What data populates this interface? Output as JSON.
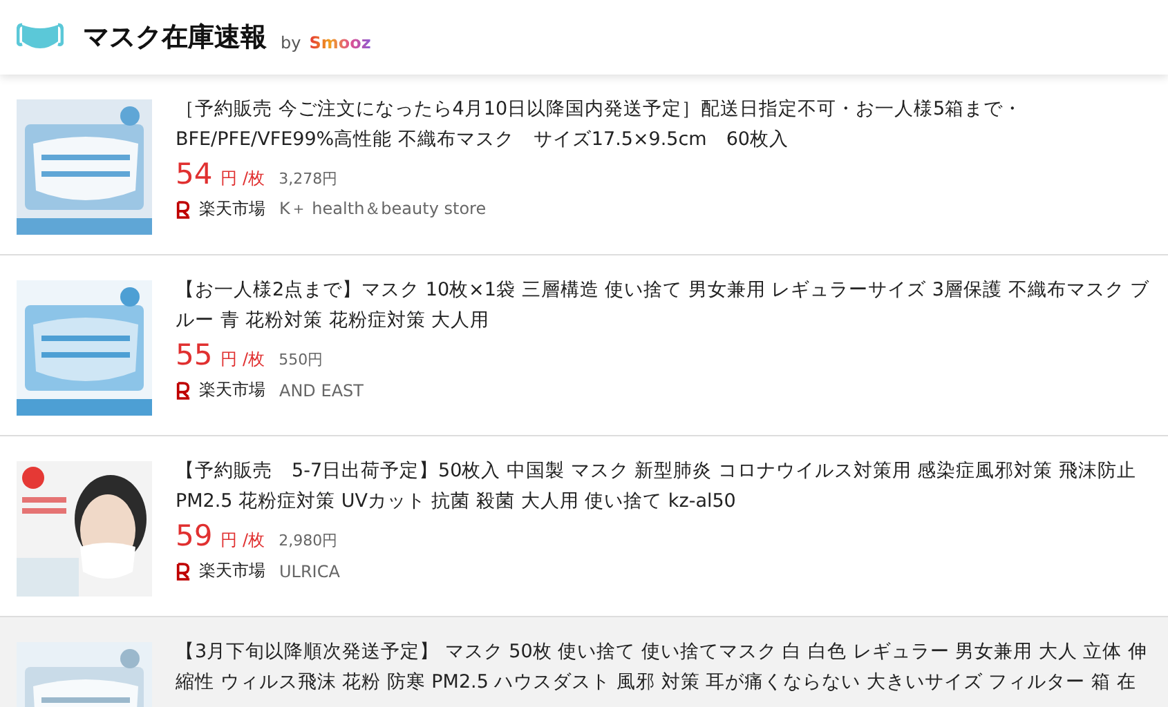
{
  "header": {
    "title": "マスク在庫速報",
    "by": "by",
    "brand": "Smooz"
  },
  "items": [
    {
      "selected": false,
      "title": "［予約販売 今ご注文になったら4月10日以降国内発送予定］配送日指定不可・お一人様5箱まで・BFE/PFE/VFE99%高性能 不織布マスク　サイズ17.5×9.5cm　60枚入",
      "unit_price": "54",
      "unit": "円 /枚",
      "total": "3,278円",
      "market": "楽天市場",
      "store": "K＋ health＆beauty store"
    },
    {
      "selected": false,
      "title": "【お一人様2点まで】マスク 10枚×1袋 三層構造 使い捨て 男女兼用 レギュラーサイズ 3層保護 不織布マスク ブルー 青 花粉対策 花粉症対策 大人用",
      "unit_price": "55",
      "unit": "円 /枚",
      "total": "550円",
      "market": "楽天市場",
      "store": "AND EAST"
    },
    {
      "selected": false,
      "title": "【予約販売　5-7日出荷予定】50枚入 中国製 マスク 新型肺炎 コロナウイルス対策用 感染症風邪対策 飛沫防止 PM2.5 花粉症対策 UVカット 抗菌 殺菌 大人用 使い捨て kz-al50",
      "unit_price": "59",
      "unit": "円 /枚",
      "total": "2,980円",
      "market": "楽天市場",
      "store": "ULRICA"
    },
    {
      "selected": true,
      "title": "【3月下旬以降順次発送予定】 マスク 50枚 使い捨て 使い捨てマスク 白 白色 レギュラー 男女兼用 大人 立体 伸縮性 ウィルス飛沫 花粉 防寒 PM2.5 ハウスダスト 風邪 対策 耳が痛くならない 大きいサイズ フィルター 箱 在"
    }
  ]
}
